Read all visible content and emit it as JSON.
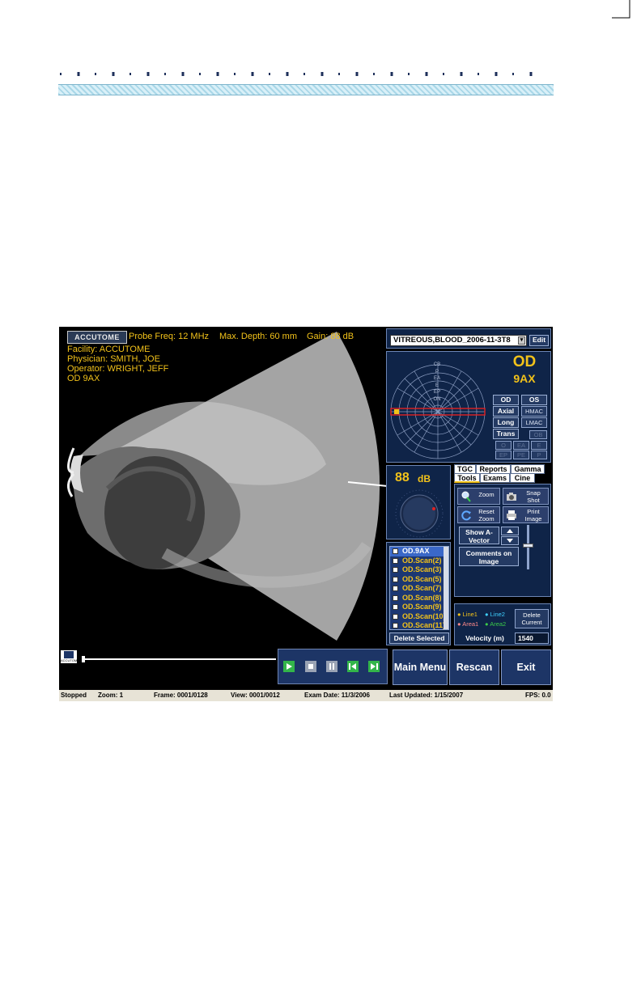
{
  "screen": {
    "header": {
      "logo": "ACCUTOME",
      "probe_freq": "Probe Freq: 12 MHz",
      "max_depth": "Max. Depth: 60 mm",
      "gain": "Gain: 88 dB",
      "facility": "Facility: ACCUTOME",
      "physician": "Physician: SMITH, JOE",
      "operator": "Operator: WRIGHT, JEFF",
      "scan_label": "OD  9AX"
    },
    "diagnosis": {
      "value": "VITREOUS,BLOOD_2006-11-3T8",
      "edit": "Edit"
    },
    "probe_position": {
      "eye": "OD",
      "position": "9AX",
      "clock_labels": [
        "CB",
        "P",
        "EA",
        "E",
        "EP",
        "ON"
      ],
      "eye_buttons": [
        "OD",
        "OS"
      ],
      "scan_buttons": [
        [
          "Axial",
          "HMAC"
        ],
        [
          "Long",
          "LMAC"
        ],
        [
          "Trans",
          "OB"
        ]
      ],
      "small_buttons": [
        [
          "O",
          "EA",
          "E"
        ],
        [
          "EP",
          "PE",
          "P"
        ]
      ]
    },
    "gain": {
      "value": "88",
      "unit": "dB"
    },
    "tabs": {
      "row1": [
        "TGC",
        "Reports",
        "Gamma"
      ],
      "row2": [
        "Tools",
        "Exams",
        "Cine"
      ]
    },
    "tools": {
      "zoom": "Zoom",
      "snapshot": "Snap Shot",
      "reset_zoom": "Reset Zoom",
      "print_image": "Print Image",
      "show_avector": "Show A-Vector",
      "comments": "Comments on Image"
    },
    "scans": {
      "items": [
        "OD.9AX",
        "OD.Scan(2)",
        "OD.Scan(3)",
        "OD.Scan(5)",
        "OD.Scan(7)",
        "OD.Scan(8)",
        "OD.Scan(9)",
        "OD.Scan(10)",
        "OD.Scan(11)"
      ],
      "delete_selected": "Delete Selected"
    },
    "measure": {
      "line1": "Line1",
      "line2": "Line2",
      "area1": "Area1",
      "area2": "Area2",
      "delete_current": "Delete Current",
      "velocity_label": "Velocity (m)",
      "velocity_value": "1540"
    },
    "cine_logo": "ACCUTOME",
    "menu": {
      "main_menu": "Main Menu",
      "rescan": "Rescan",
      "exit": "Exit"
    },
    "status": {
      "state": "Stopped",
      "zoom": "Zoom: 1",
      "frame": "Frame: 0001/0128",
      "view": "View: 0001/0012",
      "exam_date": "Exam Date: 11/3/2006",
      "last_updated": "Last Updated: 1/15/2007",
      "fps": "FPS: 0.0"
    }
  },
  "colors": {
    "overlay_text": "#f2c21a",
    "panel_bg": "#0f2448",
    "button_bg": "#243a63",
    "header_band": "#a9d7e8",
    "probe_line": "#e22222"
  }
}
